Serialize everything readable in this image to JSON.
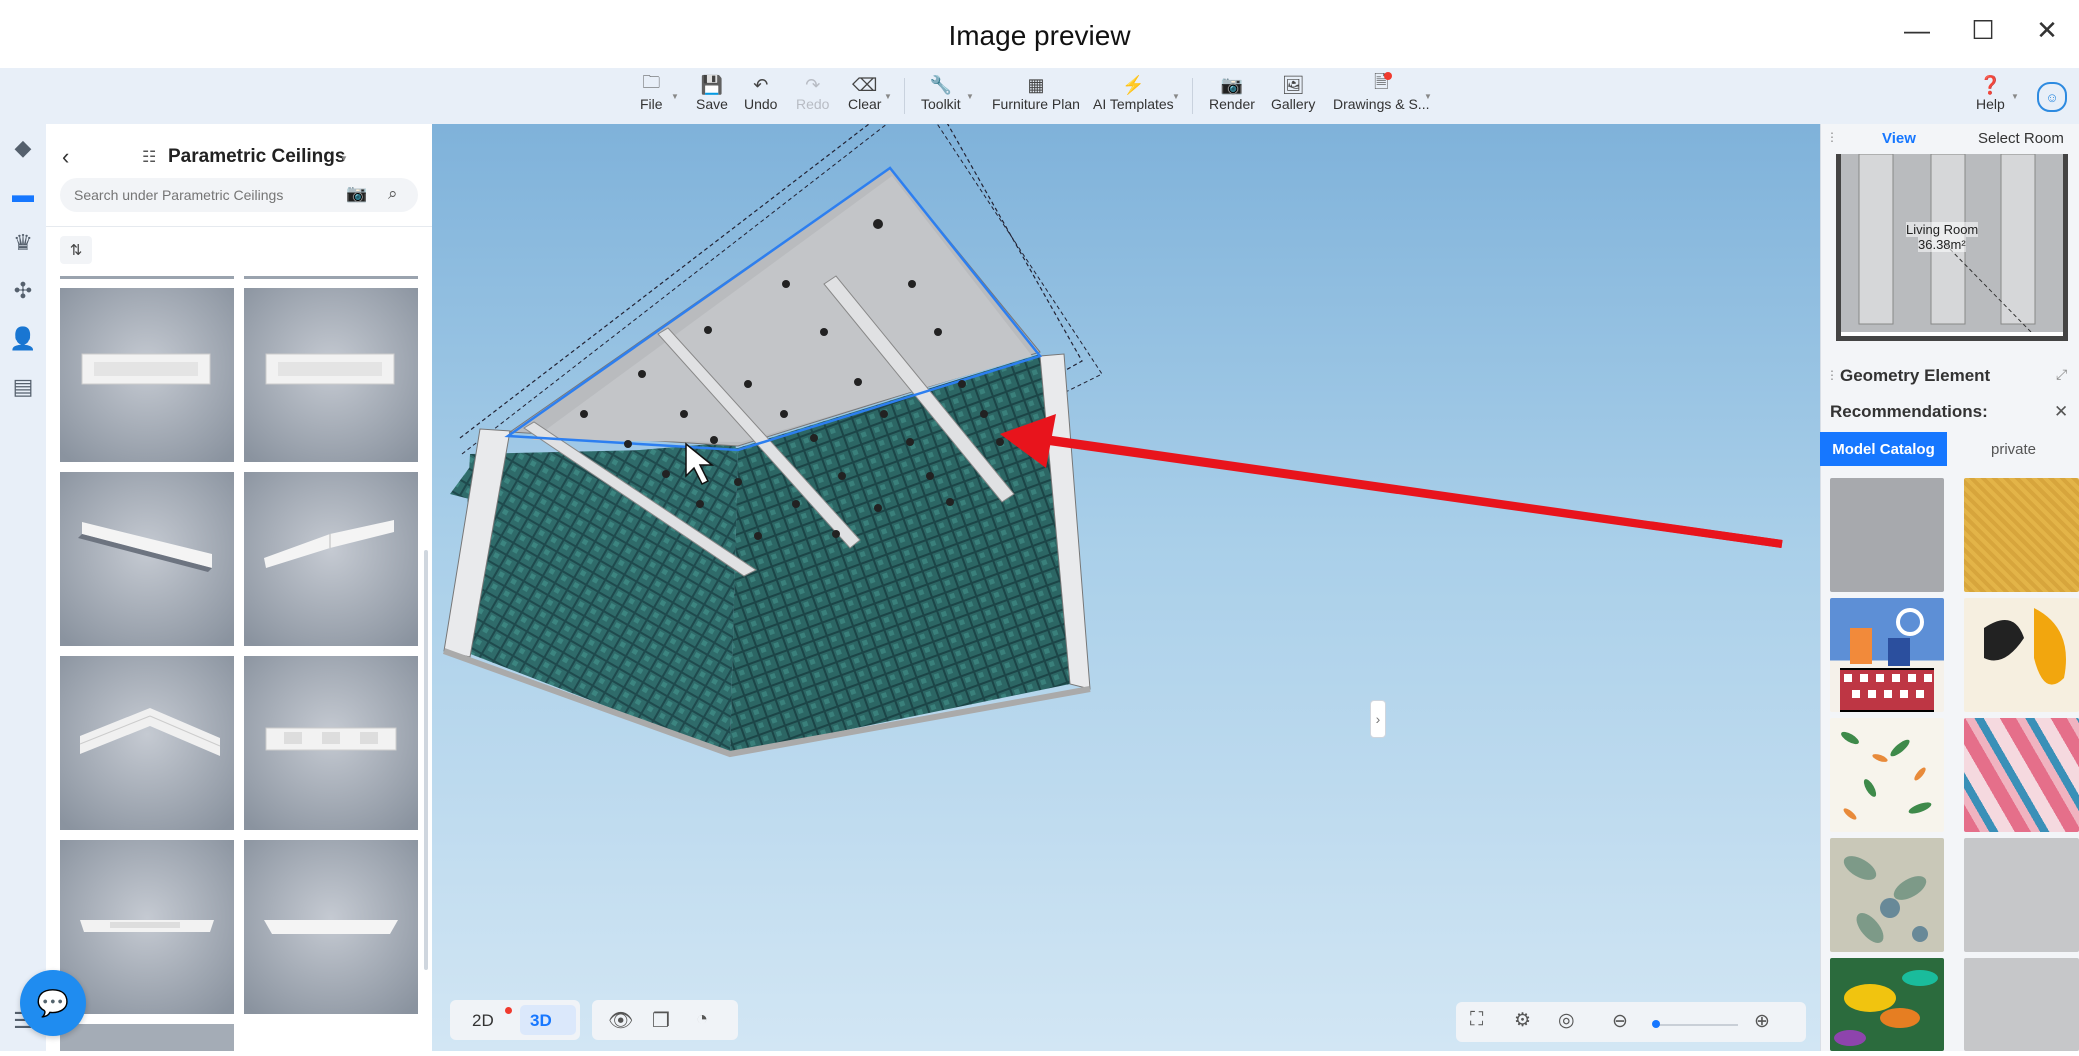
{
  "window": {
    "title": "Image preview",
    "minimize": "—",
    "maximize": "☐",
    "close": "✕"
  },
  "toolbar": {
    "file": "File",
    "save": "Save",
    "undo": "Undo",
    "redo": "Redo",
    "clear": "Clear",
    "toolkit": "Toolkit",
    "furniture_plan": "Furniture Plan",
    "ai_templates": "AI Templates",
    "render": "Render",
    "gallery": "Gallery",
    "drawings": "Drawings & S...",
    "help": "Help"
  },
  "left_panel": {
    "title": "Parametric Ceilings",
    "search_placeholder": "Search under Parametric Ceilings"
  },
  "minimap": {
    "tab_view": "View",
    "tab_select_room": "Select Room",
    "room_name": "Living Room",
    "room_area": "36.38m²"
  },
  "properties": {
    "title": "Geometry Element",
    "recommendations": "Recommendations:",
    "tab_catalog": "Model Catalog",
    "tab_private": "private"
  },
  "view_controls": {
    "mode_2d": "2D",
    "mode_3d": "3D"
  },
  "colors": {
    "accent": "#1677ff",
    "arrow": "#e8141c",
    "notify": "#f03a2e"
  },
  "zoom": {
    "level": 0.0
  }
}
